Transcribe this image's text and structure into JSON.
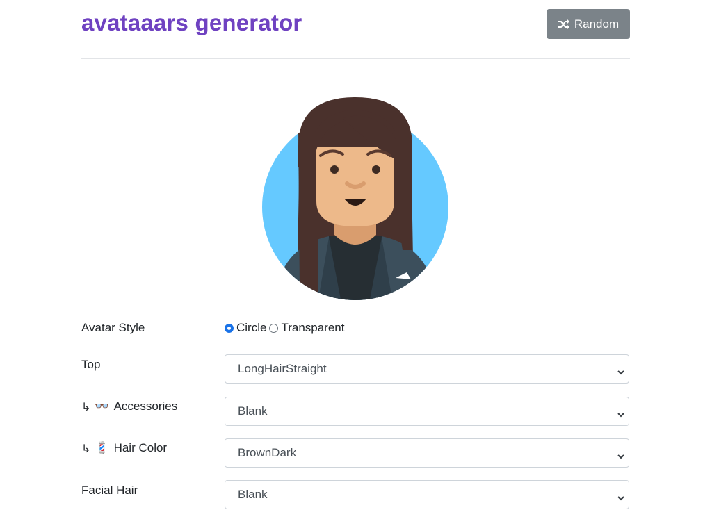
{
  "header": {
    "title": "avataaars generator",
    "random_label": "Random",
    "random_icon": "shuffle-icon"
  },
  "avatar_style": {
    "label": "Avatar Style",
    "options": [
      "Circle",
      "Transparent"
    ],
    "selected": "Circle"
  },
  "fields": [
    {
      "label": "Top",
      "prefix": "",
      "emoji": "",
      "value": "LongHairStraight"
    },
    {
      "label": "Accessories",
      "prefix": "↳",
      "emoji": "👓",
      "value": "Blank"
    },
    {
      "label": "Hair Color",
      "prefix": "↳",
      "emoji": "💈",
      "value": "BrownDark"
    },
    {
      "label": "Facial Hair",
      "prefix": "",
      "emoji": "",
      "value": "Blank"
    }
  ],
  "colors": {
    "title": "#6f42c1",
    "button": "#7b8389",
    "circle_bg": "#65c9ff",
    "hair": "#4a312c",
    "skin": "#edb98a",
    "jacket": "#3c4f5c"
  }
}
